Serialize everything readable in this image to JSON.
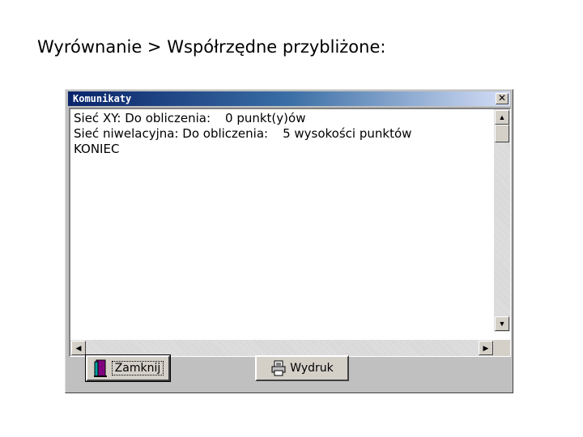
{
  "slide": {
    "title": "Wyrównanie > Współrzędne przybliżone:"
  },
  "window": {
    "title": "Komunikaty",
    "close_symbol": "✕",
    "messages": [
      {
        "prefix": "Sieć ",
        "prefix_bold": "XY: Do obliczenia:",
        "value": "0 punkt(y)ów"
      },
      {
        "prefix": "Sieć ",
        "prefix_bold": "niwelacyjna: Do obliczenia:",
        "value": "5 wysokości punktów"
      }
    ],
    "end_line": "KONIEC"
  },
  "scrollbars": {
    "up_arrow": "▲",
    "down_arrow": "▼",
    "left_arrow": "◀",
    "right_arrow": "▶"
  },
  "buttons": {
    "close_label": "Zamknij",
    "print_label": "Wydruk"
  },
  "icons": {
    "close_button_icon": "door-exit-icon",
    "print_button_icon": "printer-icon"
  }
}
